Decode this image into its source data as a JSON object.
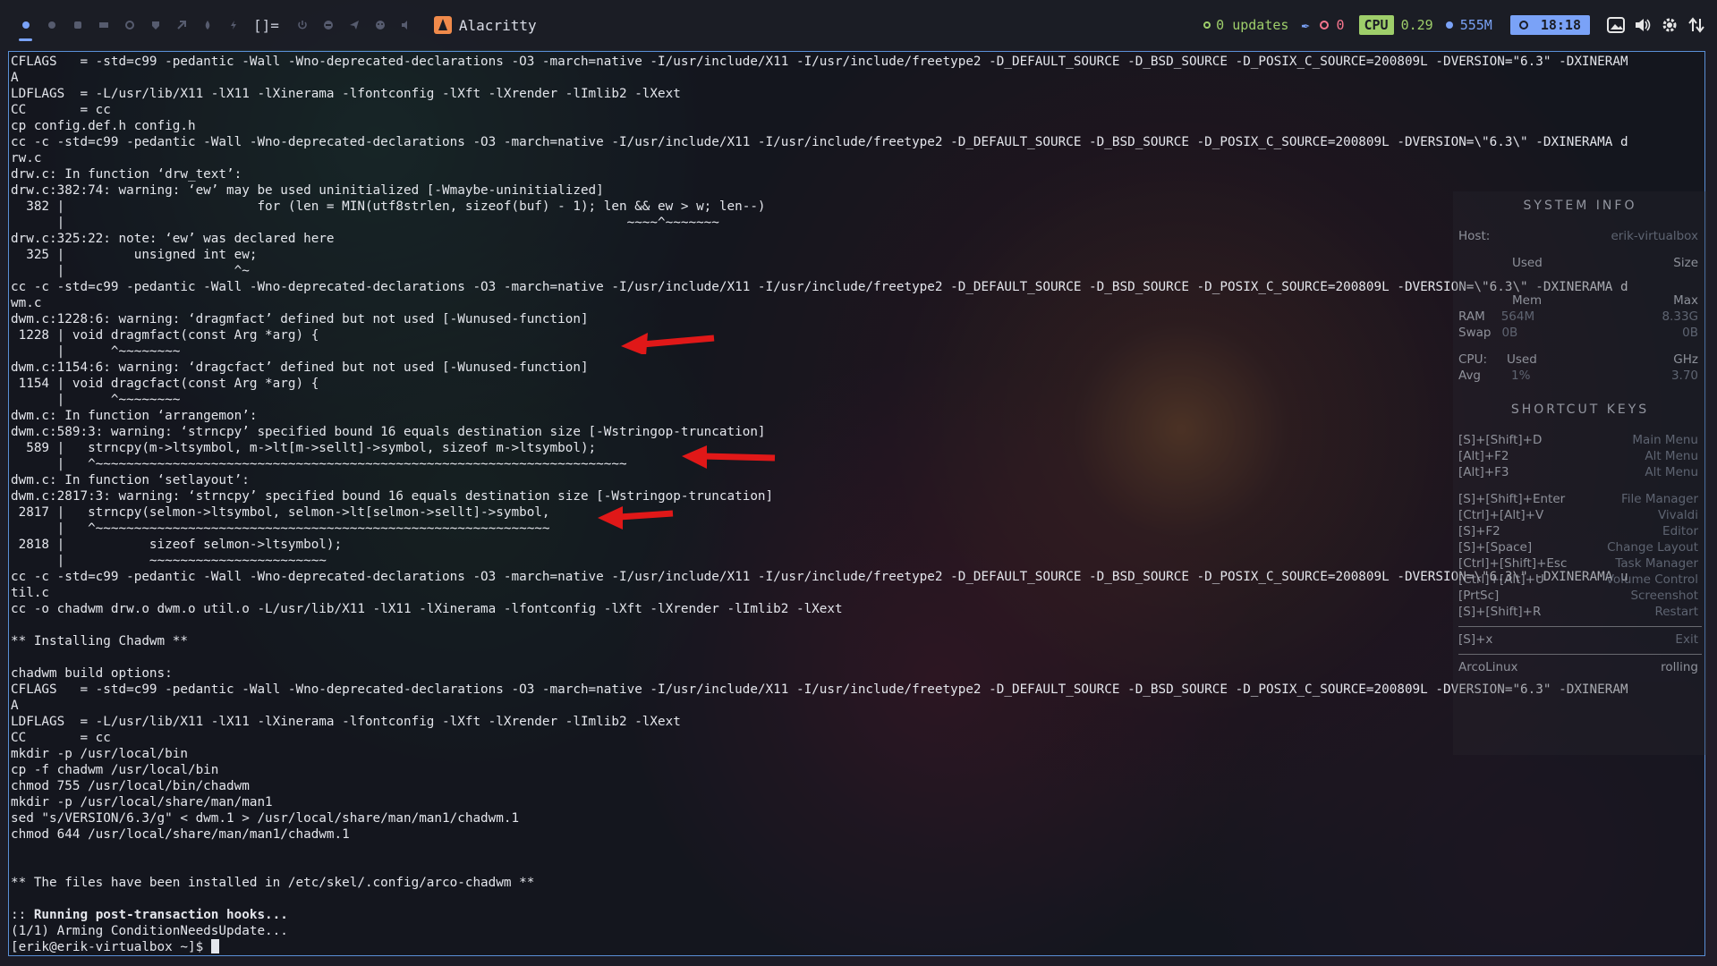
{
  "topbar": {
    "tag_icons": [
      "tag-1-icon",
      "tag-2-icon",
      "tag-3-icon",
      "tag-4-icon",
      "tag-5-icon",
      "tag-6-icon",
      "tag-7-icon",
      "tag-8-icon",
      "tag-9-icon"
    ],
    "layout_symbol": "[]=",
    "window_icons": [
      "power-icon",
      "minus-circle-icon",
      "send-icon",
      "palette-icon",
      "speaker-icon"
    ],
    "window_title": "Alacritty",
    "updates": "0 updates",
    "red_value": "0",
    "cpu_label": "CPU",
    "cpu_value": "0.29",
    "mem_value": "555M",
    "clock": "18:18",
    "accent": "#7aa2f7",
    "green": "#9ece6a",
    "red": "#f7768e"
  },
  "terminal": {
    "lines": [
      "CFLAGS   = -std=c99 -pedantic -Wall -Wno-deprecated-declarations -O3 -march=native -I/usr/include/X11 -I/usr/include/freetype2 -D_DEFAULT_SOURCE -D_BSD_SOURCE -D_POSIX_C_SOURCE=200809L -DVERSION=\"6.3\" -DXINERAM",
      "A",
      "LDFLAGS  = -L/usr/lib/X11 -lX11 -lXinerama -lfontconfig -lXft -lXrender -lImlib2 -lXext",
      "CC       = cc",
      "cp config.def.h config.h",
      "cc -c -std=c99 -pedantic -Wall -Wno-deprecated-declarations -O3 -march=native -I/usr/include/X11 -I/usr/include/freetype2 -D_DEFAULT_SOURCE -D_BSD_SOURCE -D_POSIX_C_SOURCE=200809L -DVERSION=\\\"6.3\\\" -DXINERAMA d",
      "rw.c",
      "drw.c: In function ‘drw_text’:",
      "drw.c:382:74: warning: ‘ew’ may be used uninitialized [-Wmaybe-uninitialized]",
      "  382 |                         for (len = MIN(utf8strlen, sizeof(buf) - 1); len && ew > w; len--)",
      "      |                                                                         ~~~~^~~~~~~~",
      "drw.c:325:22: note: ‘ew’ was declared here",
      "  325 |         unsigned int ew;",
      "      |                      ^~",
      "cc -c -std=c99 -pedantic -Wall -Wno-deprecated-declarations -O3 -march=native -I/usr/include/X11 -I/usr/include/freetype2 -D_DEFAULT_SOURCE -D_BSD_SOURCE -D_POSIX_C_SOURCE=200809L -DVERSION=\\\"6.3\\\" -DXINERAMA d",
      "wm.c",
      "dwm.c:1228:6: warning: ‘dragmfact’ defined but not used [-Wunused-function]",
      " 1228 | void dragmfact(const Arg *arg) {",
      "      |      ^~~~~~~~~",
      "dwm.c:1154:6: warning: ‘dragcfact’ defined but not used [-Wunused-function]",
      " 1154 | void dragcfact(const Arg *arg) {",
      "      |      ^~~~~~~~~",
      "dwm.c: In function ‘arrangemon’:",
      "dwm.c:589:3: warning: ‘strncpy’ specified bound 16 equals destination size [-Wstringop-truncation]",
      "  589 |   strncpy(m->ltsymbol, m->lt[m->sellt]->symbol, sizeof m->ltsymbol);",
      "      |   ^~~~~~~~~~~~~~~~~~~~~~~~~~~~~~~~~~~~~~~~~~~~~~~~~~~~~~~~~~~~~~~~~~~~~~",
      "dwm.c: In function ‘setlayout’:",
      "dwm.c:2817:3: warning: ‘strncpy’ specified bound 16 equals destination size [-Wstringop-truncation]",
      " 2817 |   strncpy(selmon->ltsymbol, selmon->lt[selmon->sellt]->symbol,",
      "      |   ^~~~~~~~~~~~~~~~~~~~~~~~~~~~~~~~~~~~~~~~~~~~~~~~~~~~~~~~~~~~",
      " 2818 |           sizeof selmon->ltsymbol);",
      "      |           ~~~~~~~~~~~~~~~~~~~~~~~",
      "cc -c -std=c99 -pedantic -Wall -Wno-deprecated-declarations -O3 -march=native -I/usr/include/X11 -I/usr/include/freetype2 -D_DEFAULT_SOURCE -D_BSD_SOURCE -D_POSIX_C_SOURCE=200809L -DVERSION=\\\"6.3\\\" -DXINERAMA u",
      "til.c",
      "cc -o chadwm drw.o dwm.o util.o -L/usr/lib/X11 -lX11 -lXinerama -lfontconfig -lXft -lXrender -lImlib2 -lXext",
      "",
      "** Installing Chadwm **",
      "",
      "chadwm build options:",
      "CFLAGS   = -std=c99 -pedantic -Wall -Wno-deprecated-declarations -O3 -march=native -I/usr/include/X11 -I/usr/include/freetype2 -D_DEFAULT_SOURCE -D_BSD_SOURCE -D_POSIX_C_SOURCE=200809L -DVERSION=\"6.3\" -DXINERAM",
      "A",
      "LDFLAGS  = -L/usr/lib/X11 -lX11 -lXinerama -lfontconfig -lXft -lXrender -lImlib2 -lXext",
      "CC       = cc",
      "mkdir -p /usr/local/bin",
      "cp -f chadwm /usr/local/bin",
      "chmod 755 /usr/local/bin/chadwm",
      "mkdir -p /usr/local/share/man/man1",
      "sed \"s/VERSION/6.3/g\" < dwm.1 > /usr/local/share/man/man1/chadwm.1",
      "chmod 644 /usr/local/share/man/man1/chadwm.1",
      "",
      "",
      "** The files have been installed in /etc/skel/.config/arco-chadwm **",
      "",
      ":: Running post-transaction hooks...",
      "(1/1) Arming ConditionNeedsUpdate..."
    ],
    "bold_prefix": ":: ",
    "bold_text": "Running post-transaction hooks...",
    "prompt": "[erik@erik-virtualbox ~]$ "
  },
  "conky": {
    "system_info_title": "SYSTEM INFO",
    "host_label": "Host:",
    "host_value": "erik-virtualbox",
    "used_col": "Used",
    "size_col": "Size",
    "mem_col": "Mem",
    "max_col": "Max",
    "ram_label": "RAM",
    "ram_used": "564M",
    "ram_max": "8.33G",
    "swap_label": "Swap",
    "swap_used": "0B",
    "swap_max": "0B",
    "cpu_label": "CPU:",
    "cpu_used_col": "Used",
    "cpu_ghz_col": "GHz",
    "avg_label": "Avg",
    "avg_used": "1%",
    "avg_ghz": "3.70",
    "shortcut_title": "SHORTCUT KEYS",
    "shortcuts_a": [
      {
        "key": "[S]+[Shift]+D",
        "action": "Main Menu"
      },
      {
        "key": "[Alt]+F2",
        "action": "Alt Menu"
      },
      {
        "key": "[Alt]+F3",
        "action": "Alt Menu"
      }
    ],
    "shortcuts_b": [
      {
        "key": "[S]+[Shift]+Enter",
        "action": "File Manager"
      },
      {
        "key": "[Ctrl]+[Alt]+V",
        "action": "Vivaldi"
      },
      {
        "key": "[S]+F2",
        "action": "Editor"
      },
      {
        "key": "[S]+[Space]",
        "action": "Change Layout"
      },
      {
        "key": "[Ctrl]+[Shift]+Esc",
        "action": "Task Manager"
      },
      {
        "key": "[Ctrl]+[Alt]+U",
        "action": "Volume Control"
      },
      {
        "key": "[PrtSc]",
        "action": "Screenshot"
      },
      {
        "key": "[S]+[Shift]+R",
        "action": "Restart"
      }
    ],
    "shortcuts_c": [
      {
        "key": "[S]+x",
        "action": "Exit"
      }
    ],
    "distro": "ArcoLinux",
    "release": "rolling"
  }
}
